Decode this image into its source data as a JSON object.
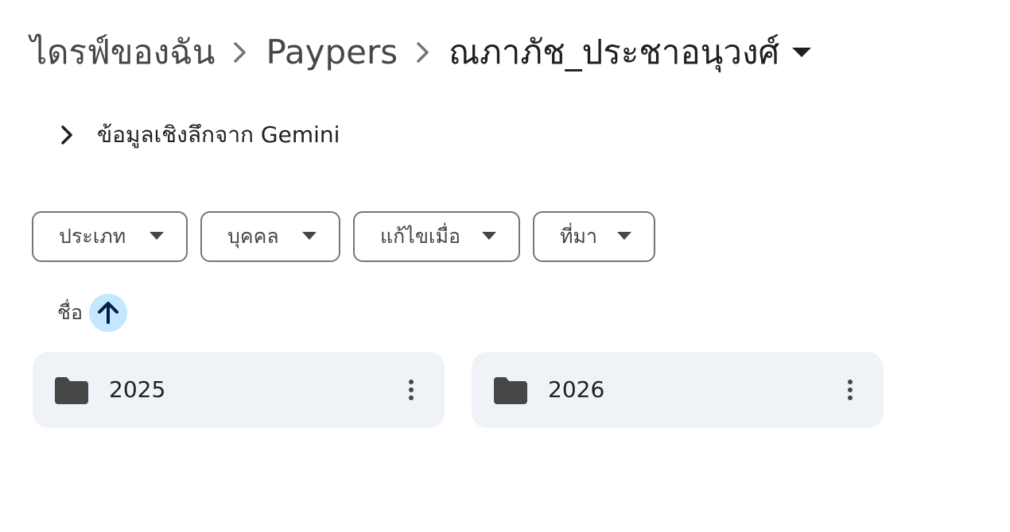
{
  "breadcrumb": {
    "items": [
      {
        "label": "ไดรฟ์ของฉัน"
      },
      {
        "label": "Paypers"
      },
      {
        "label": "ณภาภัช_ประชาอนุวงศ์"
      }
    ],
    "separator_icon": "chevron-right-icon",
    "current_dropdown_icon": "caret-down-icon"
  },
  "insights": {
    "label": "ข้อมูลเชิงลึกจาก Gemini",
    "icon": "chevron-right-icon"
  },
  "filters": [
    {
      "label": "ประเภท"
    },
    {
      "label": "บุคคล"
    },
    {
      "label": "แก้ไขเมื่อ"
    },
    {
      "label": "ที่มา"
    }
  ],
  "sort": {
    "label": "ชื่อ",
    "direction_icon": "arrow-up-icon",
    "active_color": "#c2e7ff"
  },
  "folders": [
    {
      "name": "2025",
      "icon": "folder-icon"
    },
    {
      "name": "2026",
      "icon": "folder-icon"
    }
  ],
  "colors": {
    "tile_background": "#eff3f8",
    "folder_icon": "#444746",
    "sort_arrow": "#041e49"
  }
}
